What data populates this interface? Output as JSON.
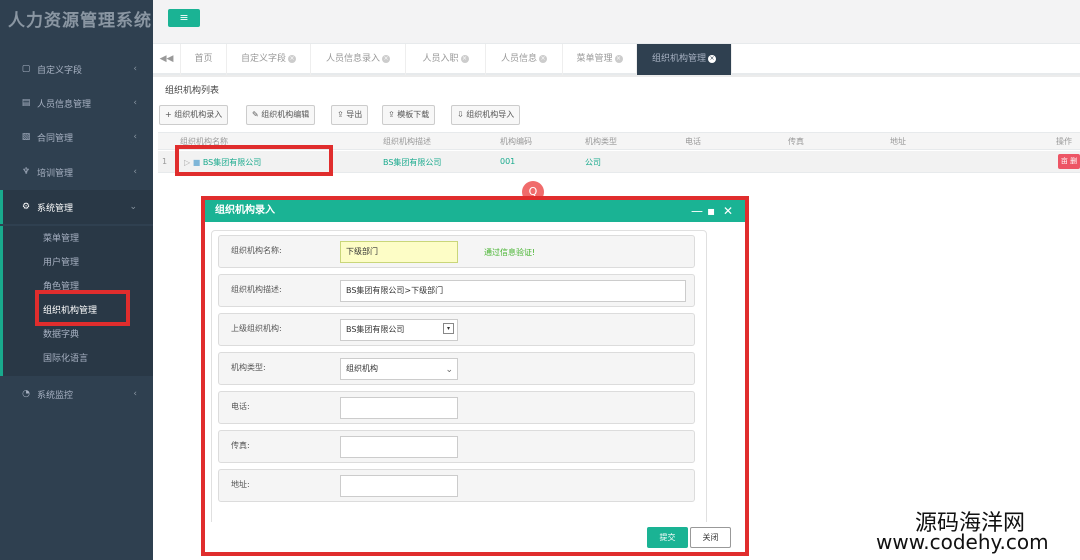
{
  "app": {
    "title": "人力资源管理系统",
    "menu_toggle": "≡"
  },
  "sidebar": {
    "items": [
      {
        "icon": "▢",
        "label": "自定义字段",
        "chevron": "‹"
      },
      {
        "icon": "▤",
        "label": "人员信息管理",
        "chevron": "‹"
      },
      {
        "icon": "▧",
        "label": "合同管理",
        "chevron": "‹"
      },
      {
        "icon": "♆",
        "label": "培训管理",
        "chevron": "‹"
      },
      {
        "icon": "⚙",
        "label": "系统管理",
        "chevron": "⌄"
      },
      {
        "icon": "◔",
        "label": "系统监控",
        "chevron": "‹"
      }
    ],
    "submenu": [
      "菜单管理",
      "用户管理",
      "角色管理",
      "组织机构管理",
      "数据字典",
      "国际化语言"
    ]
  },
  "tabs": {
    "back": "◀◀",
    "items": [
      {
        "label": "首页",
        "close": ""
      },
      {
        "label": "自定义字段",
        "close": "×"
      },
      {
        "label": "人员信息录入",
        "close": "×"
      },
      {
        "label": "人员入职",
        "close": "×"
      },
      {
        "label": "人员信息",
        "close": "×"
      },
      {
        "label": "菜单管理",
        "close": "×"
      },
      {
        "label": "组织机构管理",
        "close": "×"
      }
    ]
  },
  "list": {
    "title": "组织机构列表",
    "toolbar": [
      {
        "icon": "+",
        "label": "组织机构录入"
      },
      {
        "icon": "✎",
        "label": "组织机构编辑"
      },
      {
        "icon": "⇪",
        "label": "导出"
      },
      {
        "icon": "⇪",
        "label": "模板下载"
      },
      {
        "icon": "⇩",
        "label": "组织机构导入"
      }
    ],
    "columns": [
      "组织机构名称",
      "组织机构描述",
      "机构编码",
      "机构类型",
      "电话",
      "传真",
      "地址",
      "操作"
    ],
    "rows": [
      {
        "index": "1",
        "name": "BS集团有限公司",
        "desc": "BS集团有限公司",
        "code": "001",
        "type": "公司",
        "phone": "",
        "fax": "",
        "address": "",
        "op": "亩 删"
      }
    ],
    "search_icon": "Q"
  },
  "modal": {
    "title": "组织机构录入",
    "controls": {
      "minimize": "—",
      "maximize": "▪",
      "close": "✕"
    },
    "fields": {
      "name_label": "组织机构名称:",
      "name_value": "下级部门",
      "name_valid": "通过信息验证!",
      "desc_label": "组织机构描述:",
      "desc_value": "BS集团有限公司>下级部门",
      "parent_label": "上级组织机构:",
      "parent_value": "BS集团有限公司",
      "parent_arrow": "▾",
      "type_label": "机构类型:",
      "type_value": "组织机构",
      "type_arrow": "⌄",
      "phone_label": "电话:",
      "phone_value": "",
      "fax_label": "传真:",
      "fax_value": "",
      "address_label": "地址:",
      "address_value": ""
    },
    "submit": "提交",
    "close": "关闭"
  },
  "watermark": {
    "line1": "源码海洋网",
    "line2": "www.codehy.com"
  }
}
